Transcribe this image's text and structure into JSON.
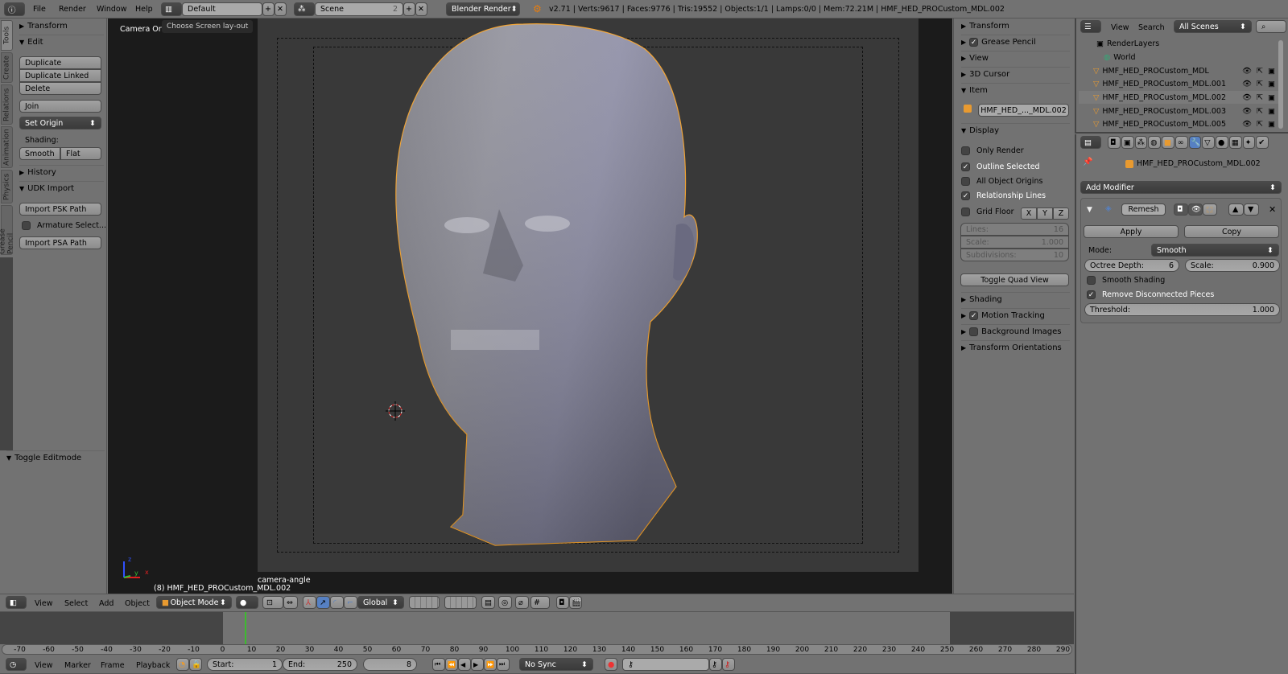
{
  "topbar": {
    "menus": [
      "File",
      "Render",
      "Window",
      "Help"
    ],
    "screen_layout": "Default",
    "scene": "Scene",
    "scene_users": "2",
    "engine": "Blender Render",
    "stats": "v2.71 | Verts:9617 | Faces:9776 | Tris:19552 | Objects:1/1 | Lamps:0/0 | Mem:72.21M | HMF_HED_PROCustom_MDL.002",
    "tooltip": "Choose Screen lay-out"
  },
  "toolshelf": {
    "tabs": [
      "Tools",
      "Create",
      "Relations",
      "Animation",
      "Physics",
      "Grease Pencil"
    ],
    "transform": "Transform",
    "edit": "Edit",
    "duplicate": "Duplicate",
    "duplicate_linked": "Duplicate Linked",
    "delete": "Delete",
    "join": "Join",
    "set_origin": "Set Origin",
    "shading_label": "Shading:",
    "smooth": "Smooth",
    "flat": "Flat",
    "history": "History",
    "udk": "UDK Import",
    "import_psk": "Import PSK Path",
    "armature_select": "Armature Select...",
    "import_psa": "Import PSA Path",
    "toggle_editmode": "Toggle Editmode"
  },
  "viewport": {
    "view_name": "Camera Ortho",
    "object_info": "(8) HMF_HED_PROCustom_MDL.002",
    "camera_label": "camera-angle",
    "axes": {
      "x": "x",
      "y": "y",
      "z": "z"
    }
  },
  "npanel": {
    "transform": "Transform",
    "grease_pencil": "Grease Pencil",
    "view": "View",
    "cursor": "3D Cursor",
    "item": "Item",
    "item_name": "HMF_HED_..._MDL.002",
    "display": "Display",
    "only_render": "Only Render",
    "outline_selected": "Outline Selected",
    "all_origins": "All Object Origins",
    "relationship_lines": "Relationship Lines",
    "grid_floor": "Grid Floor",
    "x": "X",
    "y": "Y",
    "z": "Z",
    "lines_label": "Lines:",
    "lines_val": "16",
    "scale_label": "Scale:",
    "scale_val": "1.000",
    "subdiv_label": "Subdivisions:",
    "subdiv_val": "10",
    "toggle_quad": "Toggle Quad View",
    "shading": "Shading",
    "motion_tracking": "Motion Tracking",
    "background_images": "Background Images",
    "transform_orientations": "Transform Orientations"
  },
  "outliner": {
    "view": "View",
    "search": "Search",
    "filter": "All Scenes",
    "items": [
      "RenderLayers",
      "World",
      "HMF_HED_PROCustom_MDL",
      "HMF_HED_PROCustom_MDL.001",
      "HMF_HED_PROCustom_MDL.002",
      "HMF_HED_PROCustom_MDL.003",
      "HMF_HED_PROCustom_MDL.005"
    ]
  },
  "properties": {
    "object_path": "HMF_HED_PROCustom_MDL.002",
    "add_modifier": "Add Modifier",
    "modifier_name": "Remesh",
    "apply": "Apply",
    "copy": "Copy",
    "mode_label": "Mode:",
    "mode": "Smooth",
    "octree_label": "Octree Depth:",
    "octree_val": "6",
    "scale_label": "Scale:",
    "scale_val": "0.900",
    "smooth_shading": "Smooth Shading",
    "remove_disconnected": "Remove Disconnected Pieces",
    "threshold_label": "Threshold:",
    "threshold_val": "1.000"
  },
  "view3d_header": {
    "menus": [
      "View",
      "Select",
      "Add",
      "Object"
    ],
    "mode": "Object Mode",
    "orientation": "Global"
  },
  "timeline": {
    "ticks": [
      -70,
      -60,
      -50,
      -40,
      -30,
      -20,
      -10,
      0,
      10,
      20,
      30,
      40,
      50,
      60,
      70,
      80,
      90,
      100,
      110,
      120,
      130,
      140,
      150,
      160,
      170,
      180,
      190,
      200,
      210,
      220,
      230,
      240,
      250,
      260,
      270,
      280,
      290
    ],
    "current_frame": "8",
    "menus": [
      "View",
      "Marker",
      "Frame",
      "Playback"
    ],
    "start_label": "Start:",
    "start": "1",
    "end_label": "End:",
    "end": "250",
    "sync": "No Sync"
  },
  "colors": {
    "accent": "#5680c2",
    "selection": "#f1a02c",
    "frame_line": "#3dbb2f"
  }
}
